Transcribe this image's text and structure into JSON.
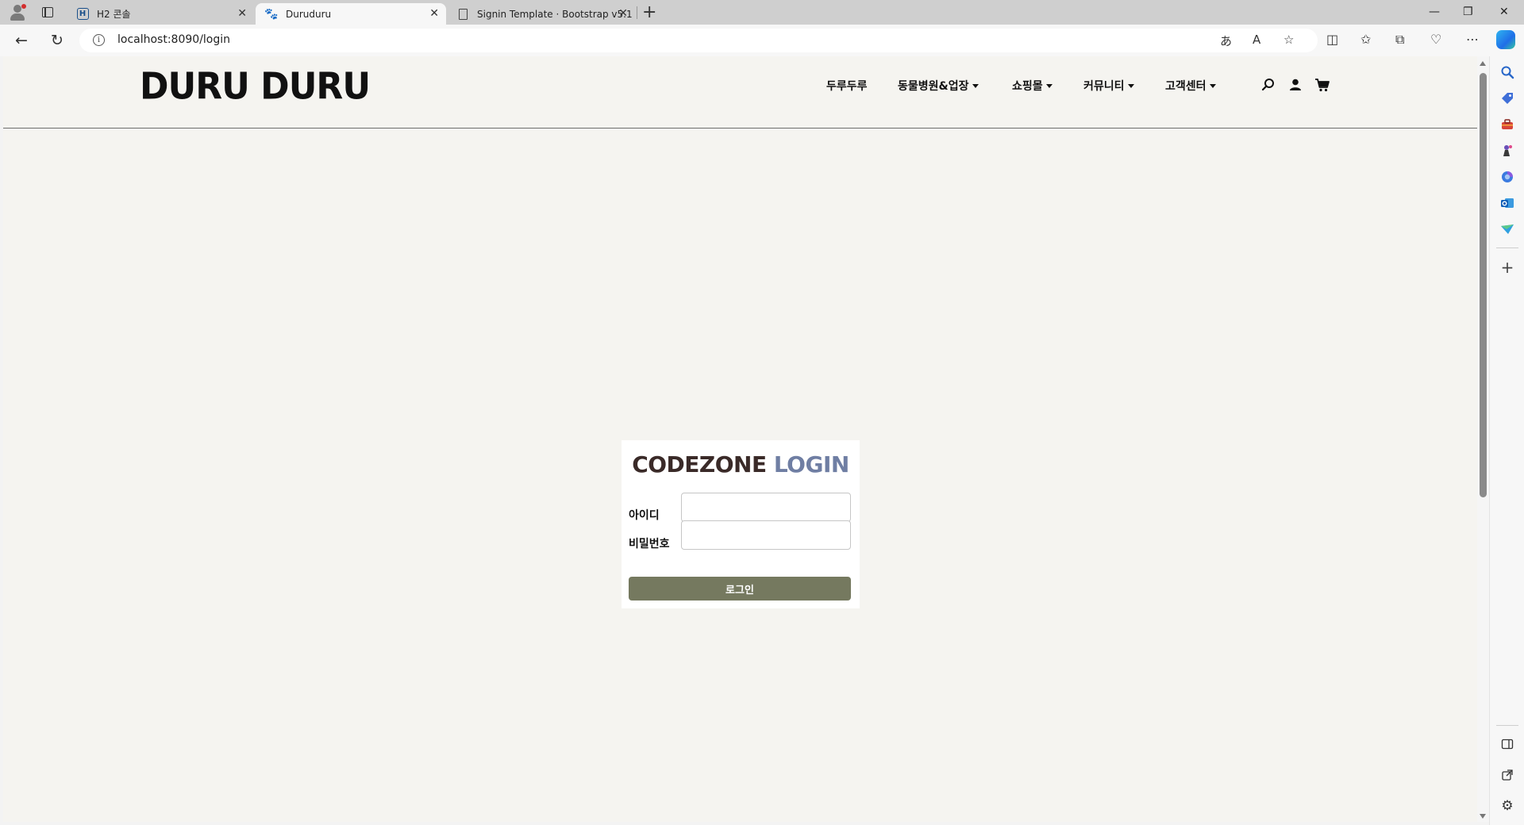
{
  "browser": {
    "tabs": [
      {
        "title": "H2 콘솔",
        "favicon": "h2-icon",
        "active": false
      },
      {
        "title": "Duruduru",
        "favicon": "paw-icon",
        "active": true
      },
      {
        "title": "Signin Template · Bootstrap v5.1",
        "favicon": "document-icon",
        "active": false
      }
    ],
    "url": "localhost:8090/login"
  },
  "site": {
    "logo": "DURU DURU",
    "nav": [
      {
        "label": "두루두루",
        "dropdown": false
      },
      {
        "label": "동물병원&업장",
        "dropdown": true
      },
      {
        "label": "쇼핑몰",
        "dropdown": true
      },
      {
        "label": "커뮤니티",
        "dropdown": true
      },
      {
        "label": "고객센터",
        "dropdown": true
      }
    ],
    "header_icons": [
      "search-icon",
      "user-icon",
      "cart-icon"
    ]
  },
  "login": {
    "title_part1": "CODEZONE",
    "title_part2": "LOGIN",
    "id_label": "아이디",
    "id_value": "",
    "password_label": "비밀번호",
    "password_value": "",
    "submit_label": "로그인"
  },
  "colors": {
    "page_bg": "#f5f4f0",
    "button": "#75795f",
    "title_dark": "#3a2a28",
    "title_accent": "#6f7ea3"
  }
}
